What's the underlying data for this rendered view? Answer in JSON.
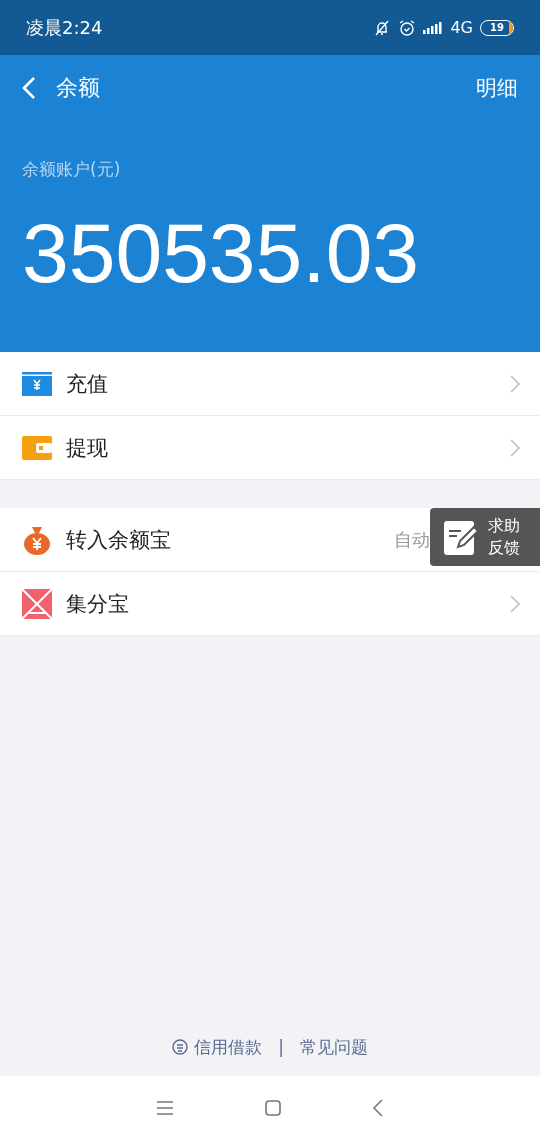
{
  "status_bar": {
    "time": "凌晨2:24",
    "network": "4G",
    "battery": "19"
  },
  "nav": {
    "title": "余额",
    "action": "明细"
  },
  "balance": {
    "label": "余额账户(元)",
    "amount": "350535.03"
  },
  "groups": [
    [
      {
        "kind": "card",
        "label": "充值",
        "arrow": true
      },
      {
        "kind": "wallet",
        "label": "提现",
        "arrow": true
      }
    ],
    [
      {
        "kind": "bag",
        "label": "转入余额宝",
        "note": "自动",
        "arrow": false
      },
      {
        "kind": "points",
        "label": "集分宝",
        "arrow": true
      }
    ]
  ],
  "feedback": {
    "line1": "求助",
    "line2": "反馈"
  },
  "footer": {
    "links": [
      "信用借款",
      "常见问题"
    ],
    "separator": "|"
  }
}
